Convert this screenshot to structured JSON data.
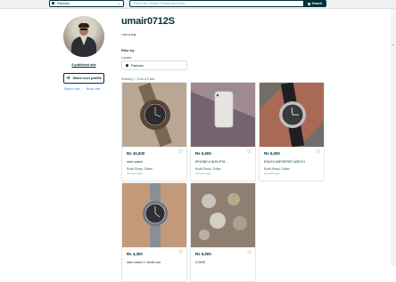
{
  "header": {
    "location": "Pakistan",
    "search_placeholder": "Find Cars, Mobile Phones and more...",
    "search_button": "Search"
  },
  "profile": {
    "username": "umair0712S",
    "bio": "i am a boy",
    "published_ads": "5 published ads",
    "share_button": "Share user profile",
    "report_user": "Report user",
    "block_user": "Block user"
  },
  "filters": {
    "title": "Filter by:",
    "location_label": "Location",
    "location_value": "Pakistan"
  },
  "results": {
    "showing": "Showing 1 - 5 out of 5 ads"
  },
  "ads": [
    {
      "price": "Rs 10,000",
      "title": "rolex watch",
      "place": "Budhi Rasal, Chiltan",
      "time": "21 hours ago"
    },
    {
      "price": "Rs 5,000",
      "title": "IPHONE 6 NON PTA",
      "place": "Budhi Rasal, Chiltan",
      "time": "21 hours ago"
    },
    {
      "price": "Rs 5,000",
      "title": "ROLEX IMPORTED WATCH",
      "place": "Budhi Rasal, Chiltan",
      "time": "21 hours ago"
    },
    {
      "price": "Rs 4,300",
      "title": "rado watch 1 month use",
      "place": "",
      "time": ""
    },
    {
      "price": "Rs 5,000",
      "title": "COINS",
      "place": "",
      "time": ""
    }
  ],
  "icons": {
    "location": "pin-icon",
    "search": "search-icon",
    "share": "share-icon",
    "favorite": "heart-icon",
    "chevron": "chevron-down-icon"
  },
  "colors": {
    "primary": "#002f34",
    "link": "#3a77ff",
    "border": "#dde0e2"
  }
}
